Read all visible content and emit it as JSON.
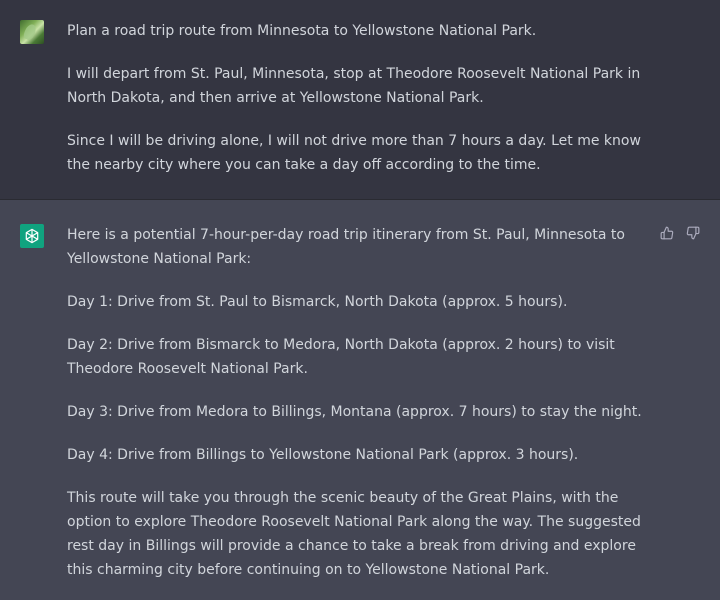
{
  "user_message": {
    "paragraphs": [
      "Plan a road trip route from Minnesota to Yellowstone National Park.",
      "I will depart from St. Paul, Minnesota, stop at Theodore Roosevelt National Park in North Dakota, and then arrive at Yellowstone National Park.",
      "Since I will be driving alone, I will not drive more than 7 hours a day. Let me know the nearby city where you can take a day off according to the time."
    ]
  },
  "assistant_message": {
    "paragraphs": [
      "Here is a potential 7-hour-per-day road trip itinerary from St. Paul, Minnesota to Yellowstone National Park:",
      "Day 1: Drive from St. Paul to Bismarck, North Dakota (approx. 5 hours).",
      "Day 2: Drive from Bismarck to Medora, North Dakota (approx. 2 hours) to visit Theodore Roosevelt National Park.",
      "Day 3: Drive from Medora to Billings, Montana (approx. 7 hours) to stay the night.",
      "Day 4: Drive from Billings to Yellowstone National Park (approx. 3 hours).",
      "This route will take you through the scenic beauty of the Great Plains, with the option to explore Theodore Roosevelt National Park along the way. The suggested rest day in Billings will provide a chance to take a break from driving and explore this charming city before continuing on to Yellowstone National Park."
    ]
  },
  "icons": {
    "assistant_avatar": "openai-logo-icon",
    "thumbs_up": "thumbs-up-icon",
    "thumbs_down": "thumbs-down-icon"
  },
  "colors": {
    "user_bg": "#343541",
    "assistant_bg": "#444654",
    "brand_green": "#10a37f",
    "text": "#d1d5db"
  }
}
